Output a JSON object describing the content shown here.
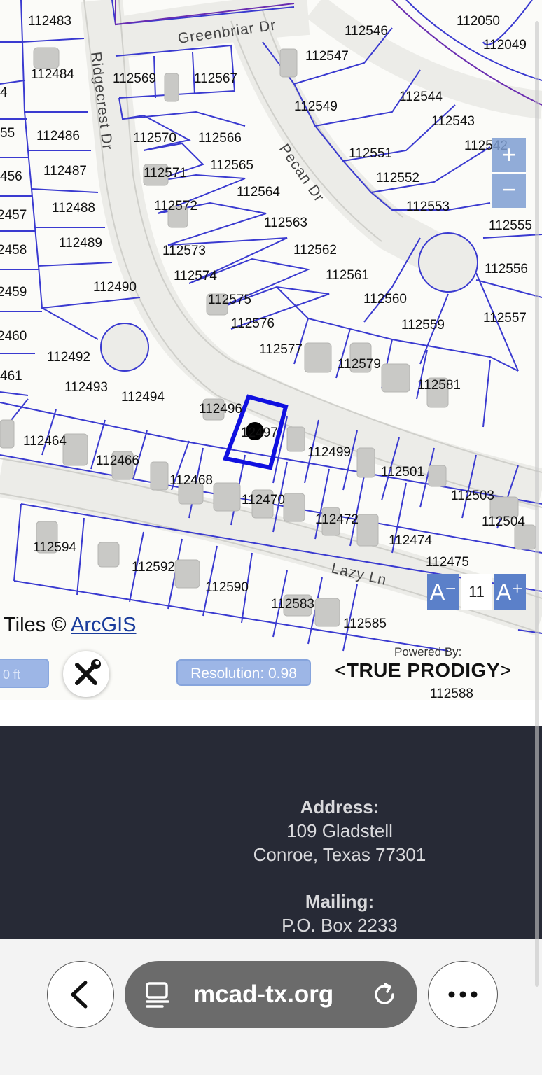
{
  "map": {
    "streets": [
      "Greenbriar Dr",
      "Ridgecrest Dr",
      "Pecan Dr",
      "Lazy Ln"
    ],
    "parcels": [
      "112483",
      "112546",
      "112050",
      "112049",
      "112484",
      "112569",
      "112567",
      "112547",
      "112549",
      "112544",
      "112486",
      "112570",
      "112566",
      "112543",
      "112542",
      "112487",
      "112571",
      "112565",
      "112551",
      "112552",
      "112488",
      "112564",
      "112572",
      "112553",
      "112555",
      "112489",
      "112563",
      "112562",
      "112573",
      "112490",
      "112574",
      "112561",
      "112556",
      "112575",
      "112560",
      "112576",
      "112559",
      "112557",
      "112492",
      "112577",
      "112579",
      "112493",
      "112494",
      "112581",
      "112496",
      "12497",
      "112464",
      "112499",
      "112466",
      "112501",
      "112468",
      "112470",
      "112503",
      "112472",
      "112504",
      "112474",
      "112594",
      "112475",
      "112592",
      "112590",
      "112583",
      "112585",
      "112588",
      "4",
      "55",
      "456",
      "2457",
      "2458",
      "2459",
      "2460",
      "461"
    ],
    "selected_parcel": "112497",
    "scale_text": "0 ft",
    "attribution_prefix": "Tiles ©",
    "attribution_link": "ArcGIS",
    "zoom_in": "+",
    "zoom_out": "−",
    "font_decrease": "A⁻",
    "font_increase": "A⁺",
    "font_level": "11",
    "resolution": "Resolution: 0.98",
    "powered_by_small": "Powered By:",
    "powered_by_brand": "TRUE PRODIGY"
  },
  "footer": {
    "address_heading": "Address:",
    "address_line1": "109 Gladstell",
    "address_line2": "Conroe, Texas 77301",
    "mailing_heading": "Mailing:",
    "mailing_line1": "P.O. Box 2233"
  },
  "browser": {
    "url": "mcad-tx.org"
  },
  "colors": {
    "parcel_line": "#3a3ad0",
    "selected_outline": "#1010e0",
    "footer_bg": "#272a36"
  }
}
